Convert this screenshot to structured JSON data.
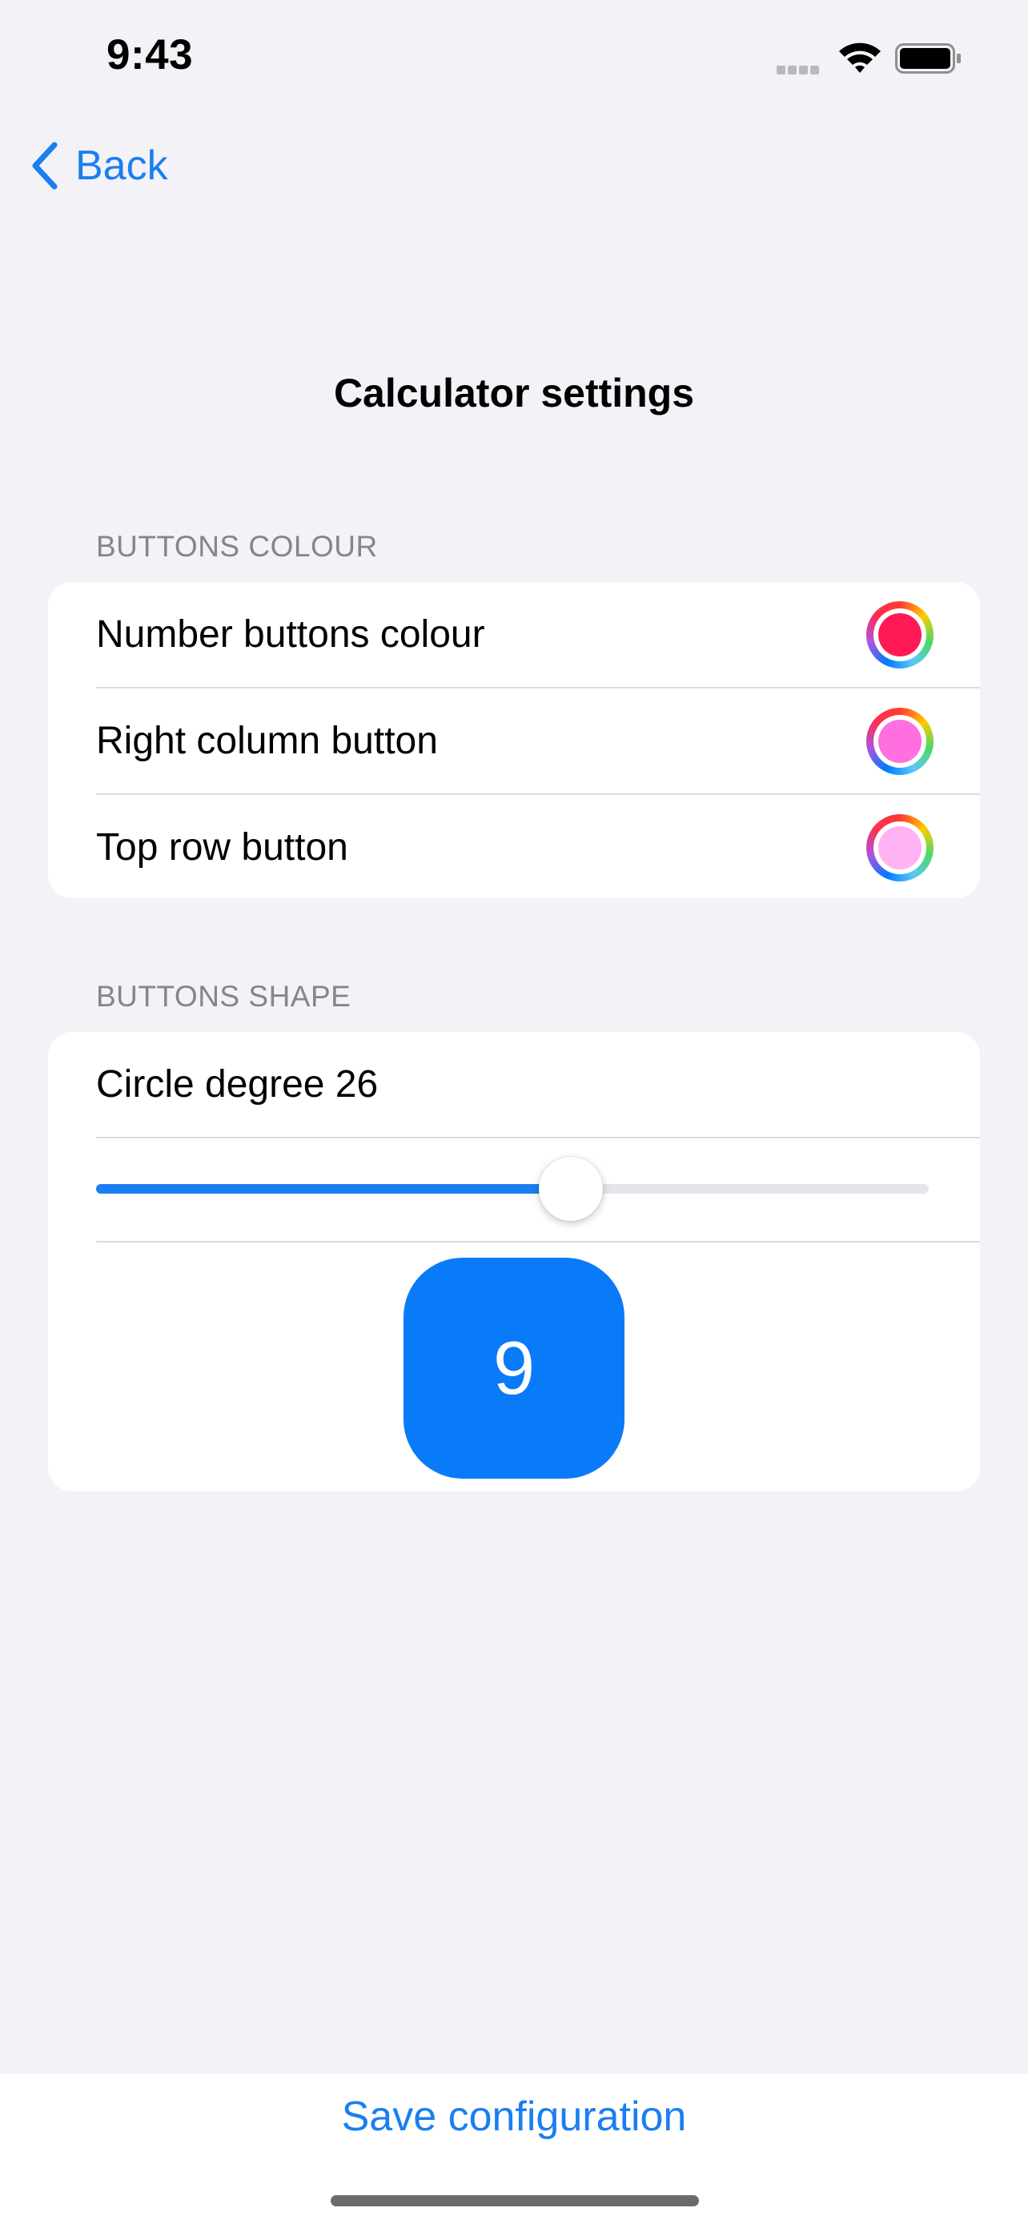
{
  "status_bar": {
    "time": "9:43"
  },
  "nav": {
    "back_label": "Back"
  },
  "page": {
    "title": "Calculator settings"
  },
  "colour_section": {
    "header": "BUTTONS COLOUR",
    "rows": [
      {
        "label": "Number buttons colour",
        "color": "#ff1a55"
      },
      {
        "label": "Right column button",
        "color": "#ff6fe0"
      },
      {
        "label": "Top row button",
        "color": "#ffb3f3"
      }
    ]
  },
  "shape_section": {
    "header": "BUTTONS SHAPE",
    "circle_degree_label": "Circle degree 26",
    "slider_fraction": 0.57,
    "preview_button_label": "9",
    "accent_color": "#0a7bf8"
  },
  "bottom": {
    "save_label": "Save configuration"
  }
}
